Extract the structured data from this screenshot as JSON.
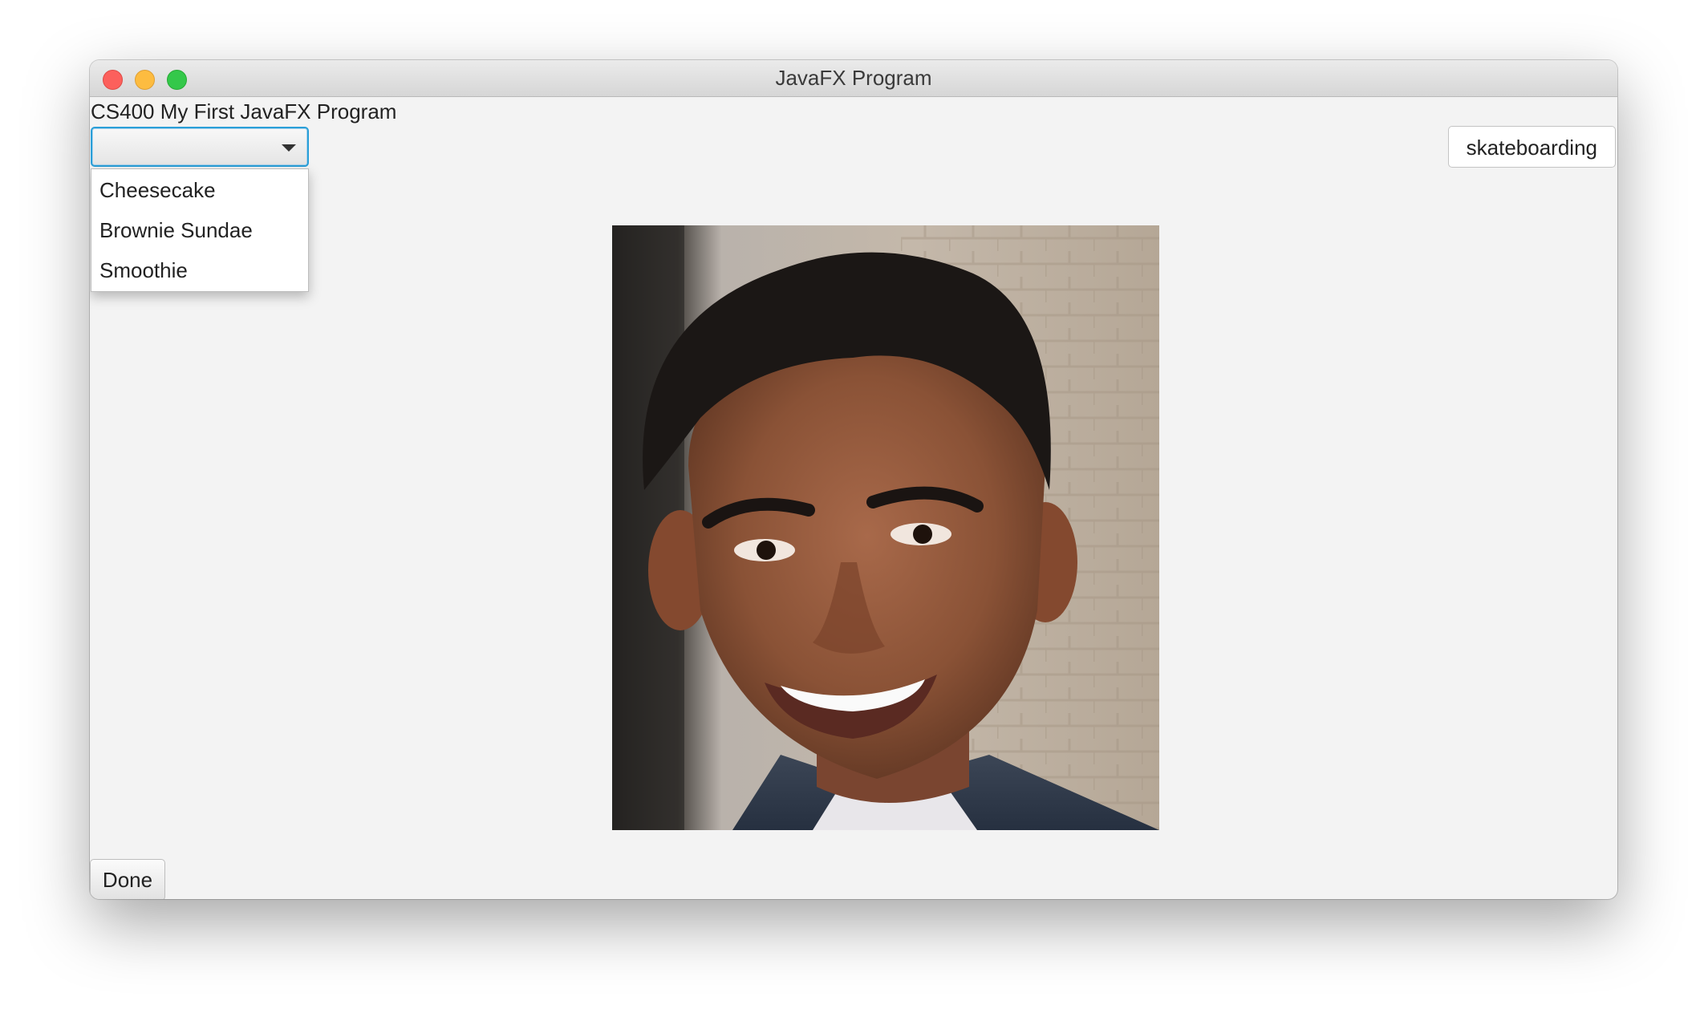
{
  "window": {
    "title": "JavaFX Program"
  },
  "app": {
    "heading": "CS400 My First JavaFX Program"
  },
  "combo": {
    "selected_value": "",
    "options": [
      "Cheesecake",
      "Brownie Sundae",
      "Smoothie"
    ]
  },
  "side_button": {
    "label": "skateboarding"
  },
  "photo": {
    "subject": "portrait-photo"
  },
  "footer": {
    "done_label": "Done"
  },
  "colors": {
    "focus_ring": "#2a9fd8",
    "close": "#fc605c",
    "minimize": "#fdbc40",
    "maximize": "#34c84a",
    "window_bg": "#f3f3f3"
  }
}
